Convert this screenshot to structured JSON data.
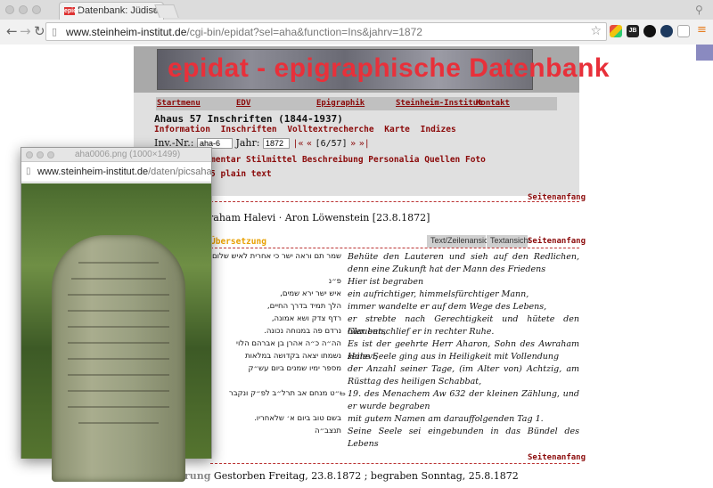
{
  "browser": {
    "tab_title": "Datenbank: Jüdische Grab",
    "tab_favicon": "epidat",
    "url_host": "www.steinheim-institut.de",
    "url_path": "/cgi-bin/epidat?sel=aha&function=Ins&jahrv=1872"
  },
  "site": {
    "banner_title": "epidat - epigraphische Datenbank",
    "menu": [
      "Startmenu",
      "EDV",
      "Epigraphik",
      "Steinheim-Institut",
      "Kontakt"
    ],
    "headline": "Ahaus 57 Inschriften (1844-1937)",
    "links": [
      "Information",
      "Inschriften",
      "Volltextrecherche",
      "Karte",
      "Indizes"
    ],
    "inv_label": "Inv.-Nr.:",
    "inv_value": "aha-6",
    "year_label": "Jahr:",
    "year_value": "1872",
    "nav_first": "|«",
    "nav_prev": "«",
    "nav_count": "[6/57]",
    "nav_next": "»",
    "nav_last": "»|",
    "tabs_visible": "mentar Stilmittel Beschreibung Personalia Quellen Foto",
    "plain_text": "5 plain text",
    "seitenanfang": "Seitenanfang",
    "person_line": "raham Halevi · Aron Löwenstein [23.8.1872]",
    "uebersetzung": "Übersetzung",
    "view_zeilen": "Text/Zeilenansicht",
    "view_text": "Textansicht",
    "inscription": [
      {
        "heb": "שמר תם וראה ישר כי אחרית לאיש שלום",
        "ger": "Behüte den Lauteren und sieh auf den Redlichen, denn eine Zukunft hat der Mann des Friedens"
      },
      {
        "heb": "פ״נ",
        "ger": "Hier ist begraben"
      },
      {
        "heb": "איש ישר ירא שמים,",
        "ger": "ein aufrichtiger, himmelsfürchtiger Mann,"
      },
      {
        "heb": "הלך תמיד בדרך החיים,",
        "ger": "immer wandelte er auf dem Wege des Lebens,"
      },
      {
        "heb": "רדף צדק ושא אמונה,",
        "ger": "er strebte nach Gerechtigkeit und hütete den Glauben,"
      },
      {
        "heb": "נרדם פה במנוחה נכונה.",
        "ger": "hier entschlief er in rechter Ruhe."
      },
      {
        "heb": "הה״ה כ״ה אהרן בן אברהם הלוי",
        "ger": "Es ist der geehrte Herr Aharon, Sohn des Awraham Halevi,"
      },
      {
        "heb": "נשמתו יצאה בקדושה במלאות",
        "ger": "seine Seele ging aus in Heiligkeit mit Vollendung"
      },
      {
        "heb": "מספר ימיו שמנים ביום עש״ק",
        "ger": "der Anzahl seiner Tage, (im Alter von) Achtzig, am Rüsttag des heiligen Schabbat,"
      },
      {
        "heb": "י״ט מנחם אב תרל״ב לפ״ק ונקבר",
        "ger": "19. des Menachem Aw 632 der kleinen Zählung, und er wurde begraben"
      },
      {
        "heb": "בשם טוב ביום א׳ שלאחריו.",
        "ger": "mit gutem Namen am darauffolgenden Tag 1."
      },
      {
        "heb": "תנצב״ה",
        "ger": "Seine Seele sei eingebunden in das Bündel des Lebens"
      }
    ],
    "datierung_label": "Datierung",
    "datierung_value": " Gestorben Freitag, 23.8.1872 ; begraben Sonntag, 25.8.1872"
  },
  "popup": {
    "title": "aha0006.png (1000×1499)",
    "url_host": "www.steinheim-institut.de",
    "url_path": "/daten/picsaha/xl/..."
  },
  "icons": {
    "back": "back-arrow-icon",
    "forward": "forward-arrow-icon",
    "reload": "reload-icon",
    "star": "bookmark-star-icon",
    "menu": "hamburger-menu-icon"
  },
  "colors": {
    "accent": "#8b0a0a",
    "banner_title": "#e8303a",
    "translation_label": "#e8a000"
  }
}
